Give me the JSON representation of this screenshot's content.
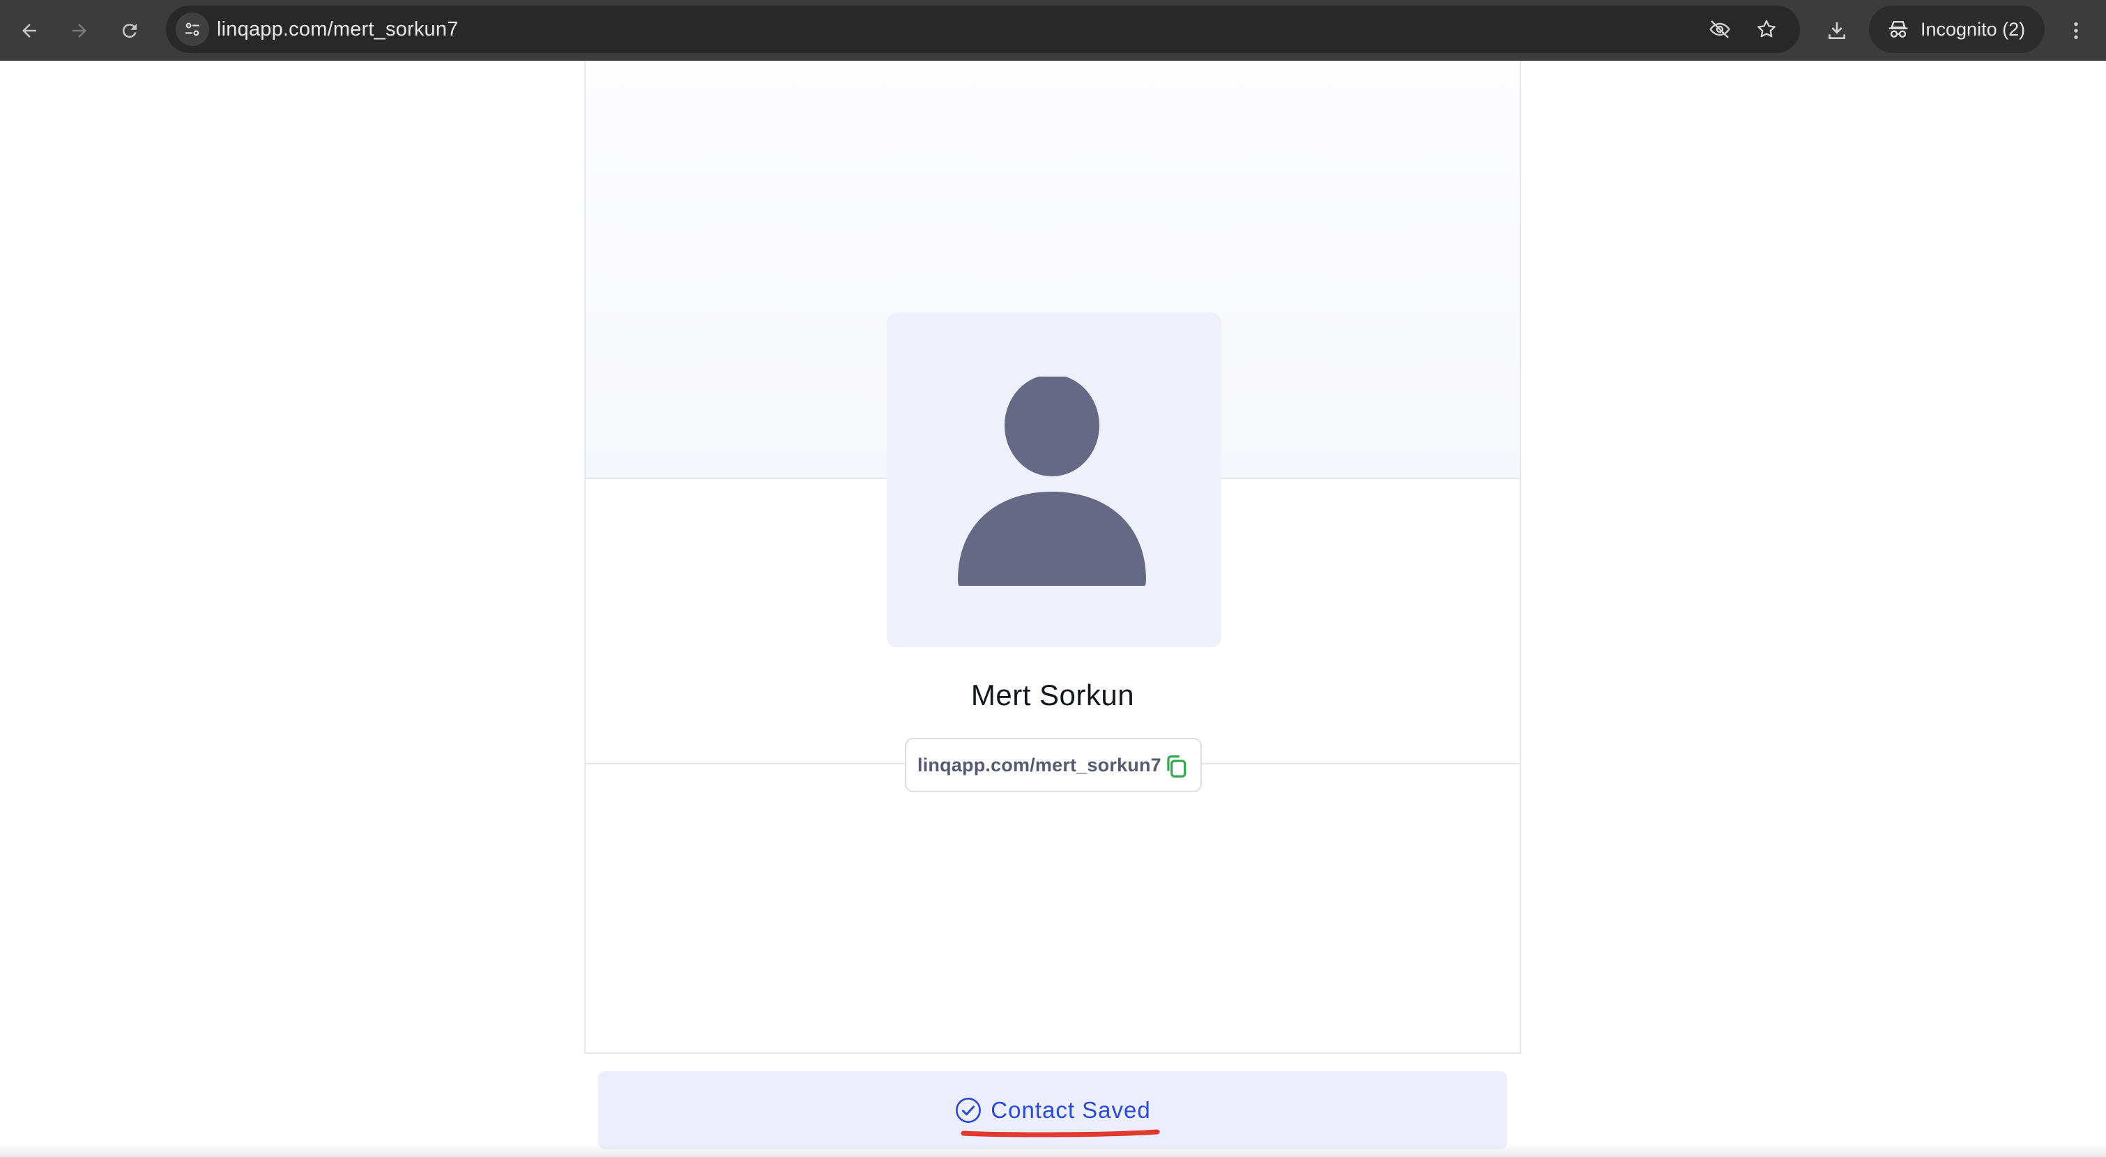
{
  "browser": {
    "url": "linqapp.com/mert_sorkun7",
    "incognito_label": "Incognito (2)",
    "icons": {
      "back": "arrow-left-icon",
      "forward": "arrow-right-icon",
      "reload": "reload-icon",
      "site_info": "tune-icon",
      "eye_off": "eye-off-icon",
      "bookmark": "star-icon",
      "download": "download-icon",
      "incognito": "incognito-icon",
      "menu": "kebab-menu-icon"
    }
  },
  "profile": {
    "name": "Mert Sorkun",
    "link": "linqapp.com/mert_sorkun7",
    "avatar_icon": "person-placeholder-icon",
    "copy_icon": "copy-icon"
  },
  "contact_status": {
    "label": "Contact Saved",
    "icon": "check-circle-icon"
  },
  "colors": {
    "browser_chrome": "#3c3c3c",
    "omnibox": "#282828",
    "avatar_bg": "#eef0fb",
    "avatar_figure": "#666985",
    "saved_text": "#2b4bd6",
    "copy_icon": "#2fa84f",
    "annotation_underline": "#e03a2f"
  }
}
